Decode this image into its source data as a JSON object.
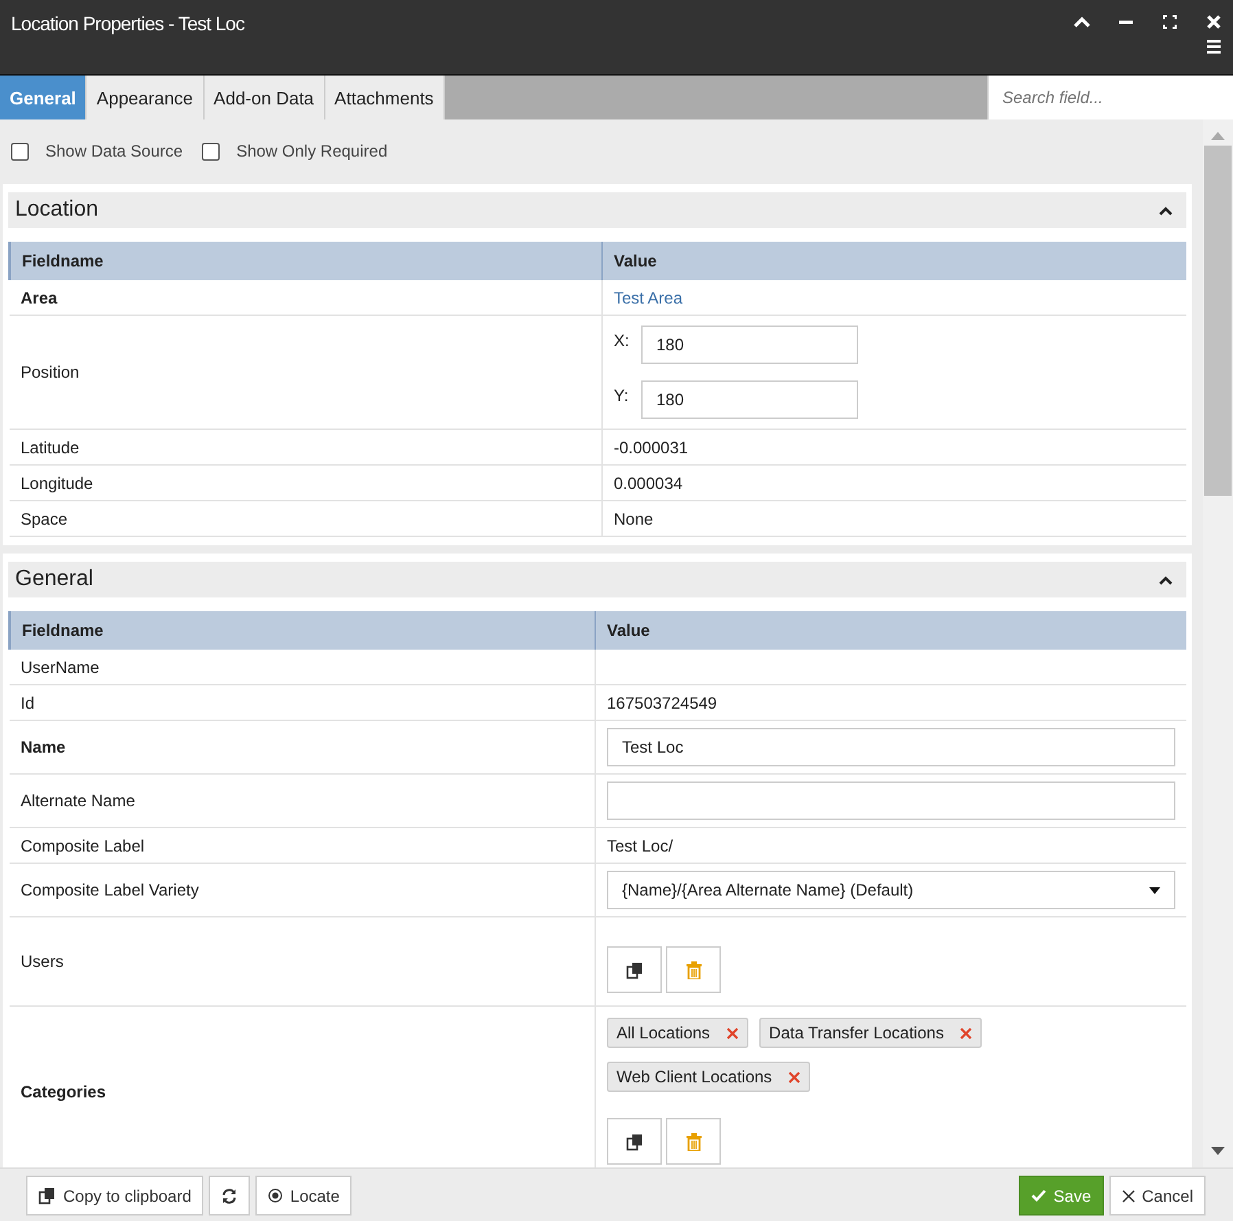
{
  "window": {
    "title": "Location Properties - Test Loc"
  },
  "tabs": [
    {
      "label": "General",
      "selected": true
    },
    {
      "label": "Appearance",
      "selected": false
    },
    {
      "label": "Add-on Data",
      "selected": false
    },
    {
      "label": "Attachments",
      "selected": false
    }
  ],
  "search": {
    "placeholder": "Search field..."
  },
  "options": [
    {
      "label": "Show Data Source",
      "checked": false
    },
    {
      "label": "Show Only Required",
      "checked": false
    }
  ],
  "sections": [
    {
      "title": "Location",
      "expanded": true,
      "columns": [
        "Fieldname",
        "Value"
      ],
      "rows": [
        {
          "label": "Area",
          "required": true,
          "kind": "link",
          "value": "Test Area"
        },
        {
          "label": "Position",
          "required": false,
          "kind": "position",
          "coords": [
            {
              "axis": "X:",
              "value": "180"
            },
            {
              "axis": "Y:",
              "value": "180"
            }
          ]
        },
        {
          "label": "Latitude",
          "required": false,
          "kind": "text",
          "value": "-0.000031"
        },
        {
          "label": "Longitude",
          "required": false,
          "kind": "text",
          "value": "0.000034"
        },
        {
          "label": "Space",
          "required": false,
          "kind": "text",
          "value": "None"
        }
      ]
    },
    {
      "title": "General",
      "expanded": true,
      "columns": [
        "Fieldname",
        "Value"
      ],
      "rows": [
        {
          "label": "UserName",
          "required": false,
          "kind": "text"
        },
        {
          "label": "Id",
          "required": false,
          "kind": "text",
          "value": "167503724549"
        },
        {
          "label": "Name",
          "required": true,
          "kind": "input",
          "value": "Test Loc"
        },
        {
          "label": "Alternate Name",
          "required": false,
          "kind": "input"
        },
        {
          "label": "Composite Label",
          "required": false,
          "kind": "text",
          "value": "Test Loc/"
        },
        {
          "label": "Composite Label Variety",
          "required": false,
          "kind": "select",
          "value": "{Name}/{Area Alternate Name} (Default)"
        },
        {
          "label": "Users",
          "required": false,
          "kind": "buttons"
        },
        {
          "label": "Categories",
          "required": true,
          "kind": "tags",
          "tags": [
            "All Locations",
            "Data Transfer Locations",
            "Web Client Locations"
          ]
        }
      ]
    }
  ],
  "footer": {
    "left": [
      {
        "kind": "copy",
        "label": "Copy to clipboard"
      },
      {
        "kind": "refresh"
      },
      {
        "kind": "locate",
        "label": "Locate"
      }
    ],
    "right": [
      {
        "kind": "save",
        "label": "Save"
      },
      {
        "kind": "cancel",
        "label": "Cancel"
      }
    ]
  }
}
